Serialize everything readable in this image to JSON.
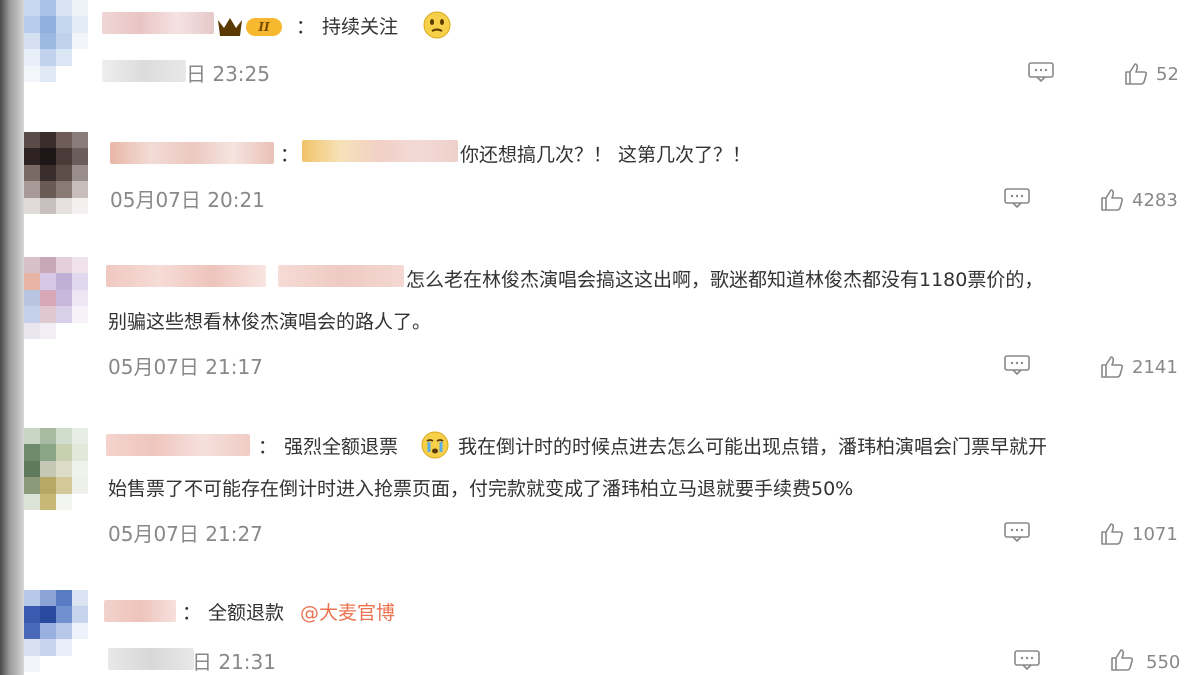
{
  "comments": [
    {
      "text": "持续关注",
      "time": "日 23:25",
      "likes": "52"
    },
    {
      "text": "你还想搞几次？！ 这第几次了？！",
      "time": "05月07日 20:21",
      "likes": "4283"
    },
    {
      "text_line1": "怎么老在林俊杰演唱会搞这这出啊，歌迷都知道林俊杰都没有1180票价的，",
      "text_line2": "别骗这些想看林俊杰演唱会的路人了。",
      "time": "05月07日 21:17",
      "likes": "2141"
    },
    {
      "text_line1a": "强烈全额退票",
      "text_line1b": "我在倒计时的时候点进去怎么可能出现点错，潘玮柏演唱会门票早就开",
      "text_line2": "始售票了不可能存在倒计时进入抢票页面，付完款就变成了潘玮柏立马退就要手续费50%",
      "time": "05月07日 21:27",
      "likes": "1071"
    },
    {
      "text": "全额退款",
      "mention": "@大麦官博",
      "time": "日 21:31",
      "likes": "550"
    }
  ],
  "colon": "：",
  "badge_text": "II",
  "icons": {
    "reply": "comment-icon",
    "like": "thumbs-up-icon",
    "vip": "crown-badge-icon",
    "emoji_think": "thinking-emoji-icon",
    "emoji_cry": "crying-emoji-icon"
  },
  "colors": {
    "mention": "#eb7350",
    "meta": "#888888",
    "text": "#333333",
    "badge": "#f5a623"
  }
}
